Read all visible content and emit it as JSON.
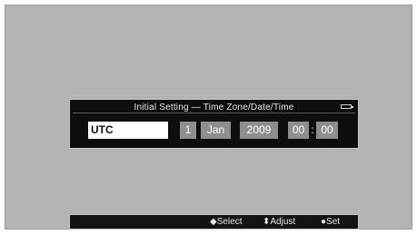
{
  "dialog": {
    "title": "Initial Setting — Time Zone/Date/Time",
    "battery_icon": "battery-icon"
  },
  "fields": {
    "time_zone": "UTC",
    "day": "1",
    "month": "Jan",
    "year": "2009",
    "hour": "00",
    "time_separator": ":",
    "minute": "00"
  },
  "hints": {
    "select": "◆Select",
    "adjust": "⬍Adjust",
    "set": "●Set"
  },
  "colors": {
    "screen_background": "#b4b4b4",
    "dialog_background": "#0e0e0e",
    "field_background": "#8e8e8e",
    "selected_field_background": "#ffffff"
  }
}
